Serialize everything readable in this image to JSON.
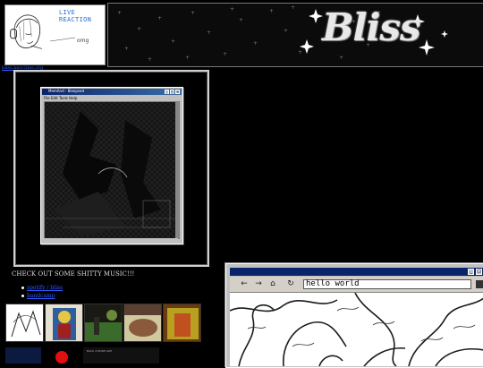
{
  "header": {
    "reaction_title": "LIVE REACTION",
    "reaction_caption": "omg",
    "logo_text": "Bliss",
    "home_link": "bliss.neocities.org"
  },
  "viewer_window": {
    "title": "MemAnd - Bleepsed",
    "menu": "File  Edit  Tools  Help"
  },
  "music": {
    "heading": "CHECK OUT SOME SHITTY MUSIC!!!",
    "links": [
      "spotify / bliss",
      "bandcamp"
    ],
    "albums": [
      {
        "name": "album-1",
        "colors": [
          "#ffffff",
          "#222222"
        ]
      },
      {
        "name": "album-2",
        "colors": [
          "#2e5e9e",
          "#e8c640"
        ]
      },
      {
        "name": "album-3",
        "colors": [
          "#3a6b2a",
          "#1a1a14"
        ]
      },
      {
        "name": "album-4",
        "colors": [
          "#8a5a3c",
          "#d0c8a0"
        ]
      },
      {
        "name": "album-5",
        "colors": [
          "#b8a020",
          "#6a3a10"
        ]
      }
    ],
    "second_row_text": "BACK 4 MORE LIKE"
  },
  "browser": {
    "address": "hello world",
    "controls": [
      "back-arrow-icon",
      "forward-arrow-icon",
      "home-icon",
      "refresh-icon"
    ]
  },
  "colors": {
    "background": "#000000",
    "link": "#2e5cff",
    "titlebar": "#0a246a",
    "chrome": "#c0c0c0"
  }
}
